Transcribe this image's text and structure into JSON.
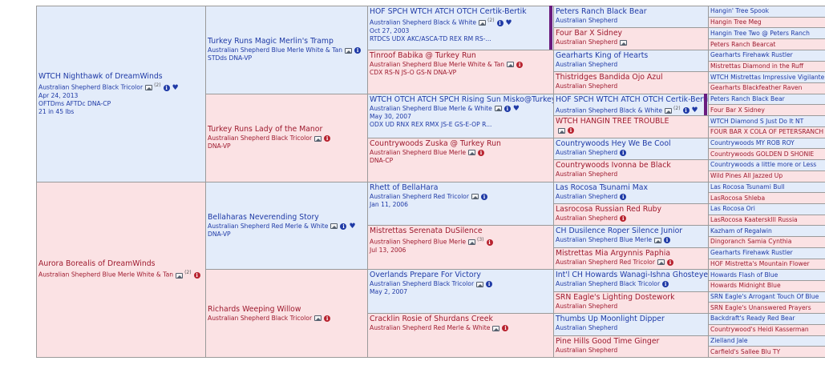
{
  "pedigree": {
    "g1": [
      {
        "name": "WTCH Nighthawk of DreamWinds",
        "breed": "Australian Shepherd Black Tricolor",
        "photo_count": "(2)",
        "info": true,
        "heart": true,
        "lines": [
          "Apr 24, 2013",
          "OFTDms AFTDc DNA-CP",
          "21 in 45 lbs"
        ]
      },
      {
        "name": "Aurora Borealis of DreamWinds",
        "breed": "Australian Shepherd Blue Merle White & Tan",
        "photo_count": "(2)",
        "info": true,
        "heart": false,
        "lines": []
      }
    ],
    "g2": [
      {
        "name": "Turkey Runs Magic Merlin's Tramp",
        "breed": "Australian Shepherd Blue Merle White & Tan",
        "info": true,
        "lines": [
          "STDds DNA-VP"
        ]
      },
      {
        "name": "Turkey Runs Lady of the Manor",
        "breed": "Australian Shepherd Black Tricolor",
        "info": true,
        "lines": [
          "DNA-VP"
        ]
      },
      {
        "name": "Bellaharas Neverending Story",
        "breed": "Australian Shepherd Red Merle & White",
        "info": true,
        "heart": true,
        "lines": [
          "DNA-VP"
        ]
      },
      {
        "name": "Richards Weeping Willow",
        "breed": "Australian Shepherd Black Tricolor",
        "info": true,
        "lines": []
      }
    ],
    "g3": [
      {
        "name": "HOF SPCH WTCH ATCH OTCH Certik-Bertik",
        "breed": "Australian Shepherd Black & White",
        "photo_count": "(2)",
        "info": true,
        "heart": true,
        "lines": [
          "Oct 27, 2003",
          "RTDCS UDX AKC/ASCA-TD REX RM RS-..."
        ]
      },
      {
        "name": "Tinroof Babika @ Turkey Run",
        "breed": "Australian Shepherd Blue Merle White & Tan",
        "info": true,
        "lines": [
          "CDX RS-N JS-O GS-N DNA-VP"
        ]
      },
      {
        "name": "WTCH OTCH ATCH SPCH Rising Sun Misko@Turkey Run",
        "breed": "Australian Shepherd Blue Merle & White",
        "info": true,
        "heart": true,
        "lines": [
          "May 30, 2007",
          "ODX UD RNX REX RMX JS-E GS-E-OP R..."
        ]
      },
      {
        "name": "Countrywoods Zuska @ Turkey Run",
        "breed": "Australian Shepherd Blue Merle",
        "info": true,
        "lines": [
          "DNA-CP"
        ]
      },
      {
        "name": "Rhett of BellaHara",
        "breed": "Australian Shepherd Red Tricolor",
        "info": true,
        "lines": [
          "Jan 11, 2006"
        ]
      },
      {
        "name": "Mistrettas Serenata DuSilence",
        "breed": "Australian Shepherd Blue Merle",
        "photo_count": "(3)",
        "info": true,
        "lines": [
          "Jul 13, 2006"
        ]
      },
      {
        "name": "Overlands Prepare For Victory",
        "breed": "Australian Shepherd Black Tricolor",
        "info": true,
        "lines": [
          "May 2, 2007"
        ]
      },
      {
        "name": "Cracklin Rosie of Shurdans Creek",
        "breed": "Australian Shepherd Red Merle & White",
        "info": true,
        "lines": []
      }
    ],
    "g4": [
      {
        "name": "Peters Ranch Black Bear",
        "breed": "Australian Shepherd",
        "photo": false,
        "info": false
      },
      {
        "name": "Four Bar X Sidney",
        "breed": "Australian Shepherd",
        "photo": true,
        "info": false
      },
      {
        "name": "Gearharts King of Hearts",
        "breed": "Australian Shepherd",
        "photo": false,
        "info": false
      },
      {
        "name": "Thistridges Bandida Ojo Azul",
        "breed": "Australian Shepherd",
        "photo": false,
        "info": false
      },
      {
        "name": "HOF SPCH WTCH ATCH OTCH Certik-Bertik",
        "breed": "Australian Shepherd Black & White",
        "photo": true,
        "photo_count": "(2)",
        "info": true,
        "heart": true
      },
      {
        "name": "WTCH HANGIN TREE TROUBLE",
        "breed": "",
        "photo": true,
        "info": true
      },
      {
        "name": "Countrywoods Hey We Be Cool",
        "breed": "Australian Shepherd",
        "photo": false,
        "info": true
      },
      {
        "name": "Countrywoods Ivonna be Black",
        "breed": "Australian Shepherd",
        "photo": false,
        "info": false
      },
      {
        "name": "Las Rocosa Tsunami Max",
        "breed": "Australian Shepherd",
        "photo": false,
        "info": true
      },
      {
        "name": "Lasrocosa Russian Red Ruby",
        "breed": "Australian Shepherd",
        "photo": false,
        "info": true
      },
      {
        "name": "CH Dusilence Roper Silence Junior",
        "breed": "Australian Shepherd Blue Merle",
        "photo": true,
        "info": true
      },
      {
        "name": "Mistrettas Mia Argynnis Paphia",
        "breed": "Australian Shepherd Red Tricolor",
        "photo": true,
        "info": true
      },
      {
        "name": "Int'l CH Howards Wanagi-Ishna Ghosteyes",
        "breed": "Australian Shepherd Black Tricolor",
        "photo": false,
        "info": true
      },
      {
        "name": "SRN Eagle's Lighting Dostework",
        "breed": "Australian Shepherd",
        "photo": false,
        "info": false
      },
      {
        "name": "Thumbs Up Moonlight Dipper",
        "breed": "Australian Shepherd",
        "photo": false,
        "info": false
      },
      {
        "name": "Pine Hills Good Time Ginger",
        "breed": "Australian Shepherd",
        "photo": false,
        "info": false
      }
    ],
    "g5": [
      "Hangin' Tree Spook",
      "Hangin Tree Meg",
      "Hangin Tree Two @ Peters Ranch",
      "Peters Ranch Bearcat",
      "Gearharts Firehawk Rustler",
      "Mistrettas Diamond in the Ruff",
      "WTCH Mistrettas Impressive Vigilante",
      "Gearharts Blackfeather Raven",
      "Peters Ranch Black Bear",
      "Four Bar X Sidney",
      "WTCH Diamond S Just Do It NT",
      "FOUR BAR X COLA OF PETERSRANCH RD",
      "Countrywoods MY ROB ROY",
      "Countrywoods GOLDEN D SHONIE",
      "Countrywoods a little more or Less",
      "Wild Pines All Jazzed Up",
      "Las Rocosa Tsunami Bull",
      "LasRocosa Shleba",
      "Las Rocosa Ori",
      "LasRocosa Kaatersklll Russia",
      "Kazham of Regalwin",
      "Dingoranch Samia Cynthia",
      "Gearharts Firehawk Rustler",
      "HOF Mistretta's Mountain Flower",
      "Howards Flash of Blue",
      "Howards Midnight Blue",
      "SRN Eagle's Arrogant Touch Of Blue",
      "SRN Eagle's Unanswered Prayers",
      "Backdraft's Ready Red Bear",
      "Countrywood's Heidi Kasserman",
      "Zielland Jale",
      "Carfield's Sallee Blu TY"
    ]
  }
}
